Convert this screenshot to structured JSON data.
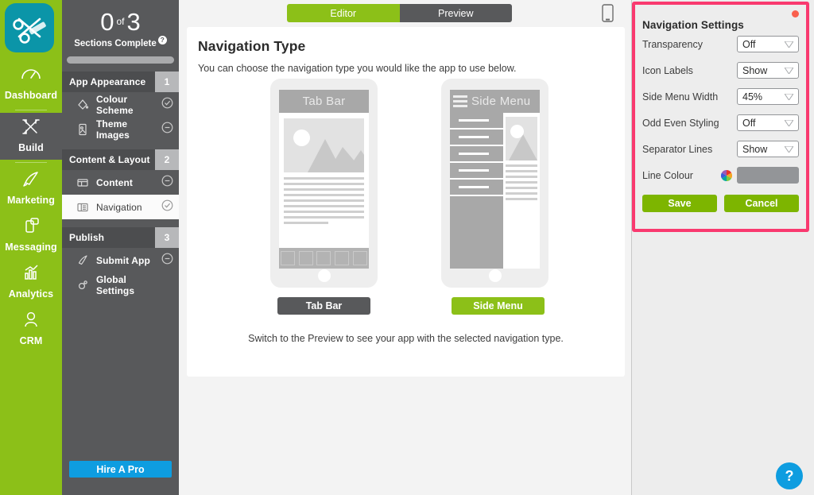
{
  "app": {
    "logo_icon": "scissors-comb-app-icon",
    "logo_color": "#0b95a8"
  },
  "rail": {
    "items": [
      {
        "label": "Dashboard",
        "icon": "gauge-icon",
        "active": false
      },
      {
        "label": "Build",
        "icon": "tools-icon",
        "active": true
      },
      {
        "label": "Marketing",
        "icon": "rocket-icon",
        "active": false
      },
      {
        "label": "Messaging",
        "icon": "phone-message-icon",
        "active": false
      },
      {
        "label": "Analytics",
        "icon": "bar-chart-icon",
        "active": false
      },
      {
        "label": "CRM",
        "icon": "person-icon",
        "active": false
      }
    ]
  },
  "progress": {
    "completed": "0",
    "of": "of",
    "total": "3",
    "caption": "Sections Complete",
    "help_badge": "?"
  },
  "steps": {
    "groups": [
      {
        "title": "App Appearance",
        "number": "1",
        "rows": [
          {
            "label": "Colour Scheme",
            "icon": "paint-bucket-icon",
            "status": "check-circle-icon",
            "selected": false
          },
          {
            "label": "Theme Images",
            "icon": "image-panel-icon",
            "status": "minus-circle-icon",
            "selected": false
          }
        ]
      },
      {
        "title": "Content & Layout",
        "number": "2",
        "rows": [
          {
            "label": "Content",
            "icon": "layout-icon",
            "status": "minus-circle-icon",
            "selected": false
          },
          {
            "label": "Navigation",
            "icon": "navigation-layout-icon",
            "status": "check-circle-icon",
            "selected": true
          }
        ]
      },
      {
        "title": "Publish",
        "number": "3",
        "rows": [
          {
            "label": "Submit App",
            "icon": "paper-plane-icon",
            "status": "minus-circle-icon",
            "selected": false
          },
          {
            "label": "Global Settings",
            "icon": "gear-icon",
            "status": "",
            "selected": false
          }
        ]
      }
    ],
    "hire_a_pro": "Hire A Pro"
  },
  "toolbar": {
    "tabs": [
      {
        "label": "Editor",
        "active": true
      },
      {
        "label": "Preview",
        "active": false
      }
    ],
    "device_icon": "mobile-phone-icon"
  },
  "main": {
    "title": "Navigation Type",
    "lead": "You can choose the navigation type you would like the app to use below.",
    "footnote": "Switch to the Preview to see your app with the selected navigation type.",
    "options": [
      {
        "mock_title": "Tab Bar",
        "button_label": "Tab Bar",
        "selected": false
      },
      {
        "mock_title": "Side Menu",
        "button_label": "Side Menu",
        "selected": true
      }
    ],
    "mock_icons": [
      "home-icon",
      "gallery-icon",
      "heart-icon",
      "map-pin-icon",
      "calendar-icon"
    ],
    "arrow_icon": "pink-pointer-arrow"
  },
  "settings": {
    "title": "Navigation Settings",
    "close_dot": "unsaved-changes-dot",
    "fields": [
      {
        "label": "Transparency",
        "value": "Off",
        "type": "select"
      },
      {
        "label": "Icon Labels",
        "value": "Show",
        "type": "select"
      },
      {
        "label": "Side Menu Width",
        "value": "45%",
        "type": "select"
      },
      {
        "label": "Odd Even Styling",
        "value": "Off",
        "type": "select"
      },
      {
        "label": "Separator Lines",
        "value": "Show",
        "type": "select"
      },
      {
        "label": "Line Colour",
        "value": "#939598",
        "type": "colour"
      }
    ],
    "save_label": "Save",
    "cancel_label": "Cancel",
    "accent_border": "#f9396f",
    "button_colour": "#7db500"
  },
  "help": {
    "label": "?",
    "icon": "question-mark-icon"
  }
}
